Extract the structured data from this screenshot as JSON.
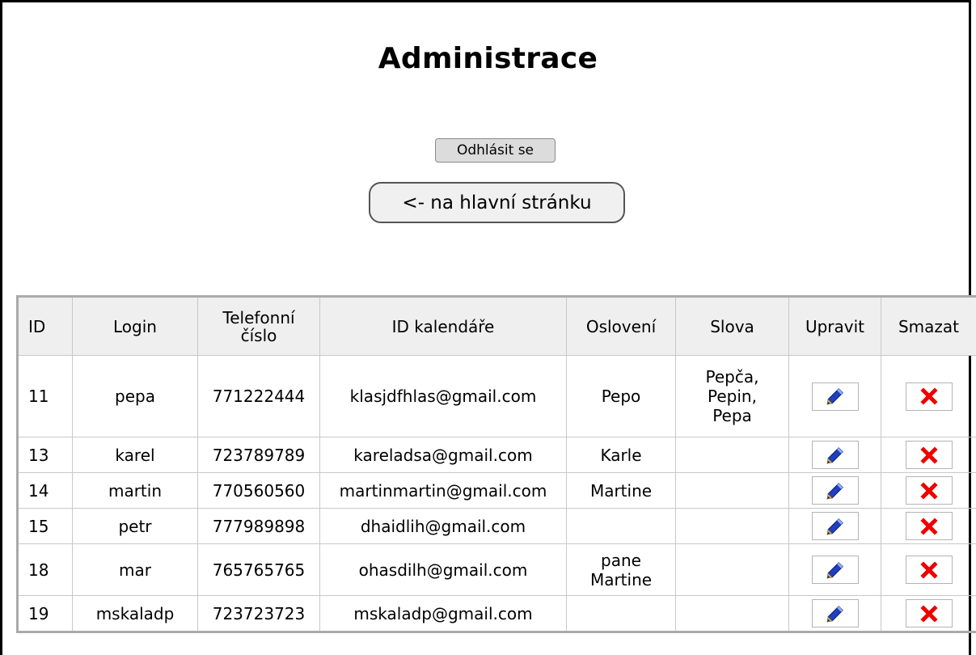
{
  "page": {
    "title": "Administrace"
  },
  "actions": {
    "logout_label": "Odhlásit se",
    "home_label": "<- na hlavní stránku"
  },
  "table": {
    "headers": {
      "id": "ID",
      "login": "Login",
      "phone_line1": "Telefonní",
      "phone_line2": "číslo",
      "calendar": "ID kalendáře",
      "salutation": "Oslovení",
      "words": "Slova",
      "edit": "Upravit",
      "delete": "Smazat"
    },
    "rows": [
      {
        "id": "11",
        "login": "pepa",
        "phone": "771222444",
        "calendar": "klasjdfhlas@gmail.com",
        "salutation": "Pepo",
        "words": [
          "Pepča,",
          "Pepin,",
          "Pepa"
        ]
      },
      {
        "id": "13",
        "login": "karel",
        "phone": "723789789",
        "calendar": "kareladsa@gmail.com",
        "salutation": "Karle",
        "words": []
      },
      {
        "id": "14",
        "login": "martin",
        "phone": "770560560",
        "calendar": "martinmartin@gmail.com",
        "salutation": "Martine",
        "words": []
      },
      {
        "id": "15",
        "login": "petr",
        "phone": "777989898",
        "calendar": "dhaidlih@gmail.com",
        "salutation": "",
        "words": []
      },
      {
        "id": "18",
        "login": "mar",
        "phone": "765765765",
        "calendar": "ohasdilh@gmail.com",
        "salutation": "pane Martine",
        "salutation_lines": [
          "pane",
          "Martine"
        ],
        "words": []
      },
      {
        "id": "19",
        "login": "mskaladp",
        "phone": "723723723",
        "calendar": "mskaladp@gmail.com",
        "salutation": "",
        "words": []
      }
    ]
  },
  "icons": {
    "edit": "pencil-icon",
    "delete": "close-x-icon"
  },
  "colors": {
    "delete_icon": "#ee0000",
    "edit_icon": "#1f3fbf",
    "header_bg": "#efefef"
  }
}
